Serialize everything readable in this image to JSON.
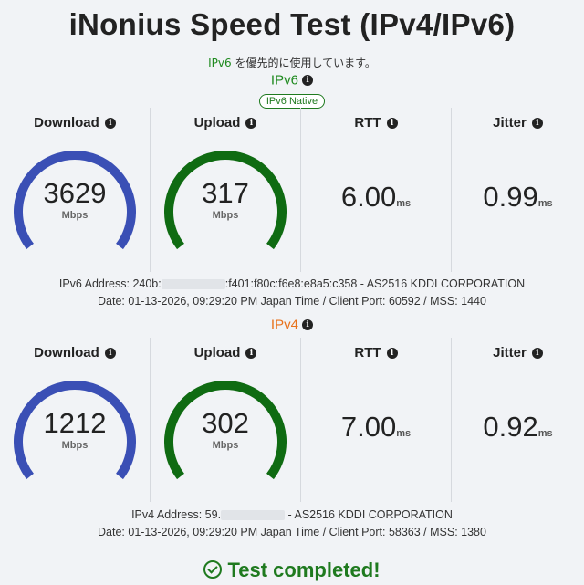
{
  "title": "iNonius Speed Test (IPv4/IPv6)",
  "preference": {
    "highlight": "IPv6",
    "text": " を優先的に使用しています。"
  },
  "ipv6": {
    "label": "IPv6",
    "label_color": "#1f8a1f",
    "badge": "IPv6 Native",
    "download": {
      "title": "Download",
      "value": "3629",
      "unit": "Mbps",
      "color": "#3a4fb5"
    },
    "upload": {
      "title": "Upload",
      "value": "317",
      "unit": "Mbps",
      "color": "#0f6b12"
    },
    "rtt": {
      "title": "RTT",
      "value": "6.00",
      "unit": "ms"
    },
    "jitter": {
      "title": "Jitter",
      "value": "0.99",
      "unit": "ms"
    },
    "address_prefix": "IPv6 Address: 240b:",
    "address_suffix": ":f401:f80c:f6e8:e8a5:c358 - AS2516 KDDI CORPORATION",
    "date_line": "Date: 01-13-2026, 09:29:20 PM Japan Time / Client Port: 60592 / MSS: 1440"
  },
  "ipv4": {
    "label": "IPv4",
    "label_color": "#e8721c",
    "download": {
      "title": "Download",
      "value": "1212",
      "unit": "Mbps",
      "color": "#3a4fb5"
    },
    "upload": {
      "title": "Upload",
      "value": "302",
      "unit": "Mbps",
      "color": "#0f6b12"
    },
    "rtt": {
      "title": "RTT",
      "value": "7.00",
      "unit": "ms"
    },
    "jitter": {
      "title": "Jitter",
      "value": "0.92",
      "unit": "ms"
    },
    "address_prefix": "IPv4 Address: 59.",
    "address_suffix": " - AS2516 KDDI CORPORATION",
    "date_line": "Date: 01-13-2026, 09:29:20 PM Japan Time / Client Port: 58363 / MSS: 1380"
  },
  "status": {
    "text": "Test completed!",
    "icon": "check-circle-icon",
    "color": "#1f7a1f"
  },
  "info_glyph": "i"
}
